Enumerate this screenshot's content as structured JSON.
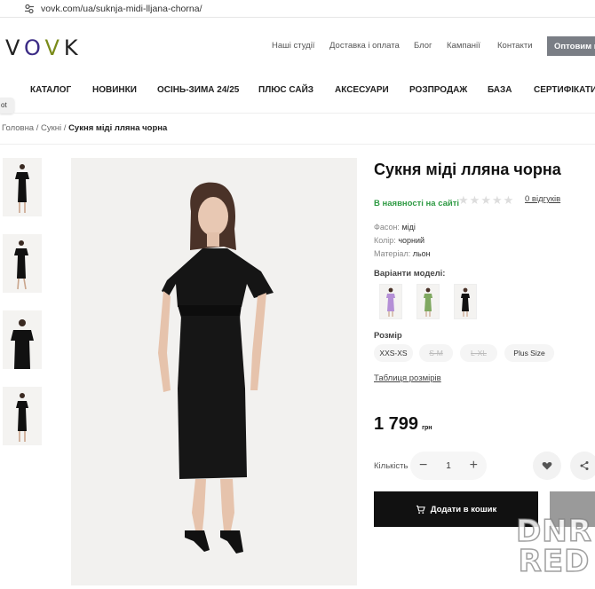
{
  "browser": {
    "url": "vovk.com/ua/suknja-midi-lljana-chorna/"
  },
  "header": {
    "logo": "VOVK",
    "top_links": [
      "Наші студії",
      "Доставка і оплата",
      "Блог",
      "Кампанії",
      "Контакти"
    ],
    "wholesale_label": "Оптовим п"
  },
  "main_nav": [
    "КАТАЛОГ",
    "НОВИНКИ",
    "ОСІНЬ-ЗИМА 24/25",
    "ПЛЮС САЙЗ",
    "АКСЕСУАРИ",
    "РОЗПРОДАЖ",
    "БАЗА",
    "СЕРТИФІКАТИ"
  ],
  "side_tab": "ot",
  "breadcrumb": {
    "home": "Головна",
    "sep": "/",
    "category": "Сукні",
    "current": "Сукня міді лляна чорна"
  },
  "product": {
    "title": "Сукня міді лляна чорна",
    "availability": "В наявності на сайті",
    "rating": 0,
    "reviews": "0 відгуків",
    "attributes": [
      {
        "label": "Фасон:",
        "value": "міді"
      },
      {
        "label": "Колір:",
        "value": "чорний"
      },
      {
        "label": "Матеріал:",
        "value": "льон"
      }
    ],
    "variants_label": "Варіанти моделі:",
    "variant_colors": [
      "#b48fd6",
      "#7fa860",
      "#111111"
    ],
    "size_label": "Розмір",
    "sizes": [
      {
        "label": "XXS-XS",
        "available": true
      },
      {
        "label": "S-M",
        "available": false
      },
      {
        "label": "L-XL",
        "available": false
      },
      {
        "label": "Plus Size",
        "available": true
      }
    ],
    "size_table": "Таблиця розмірів",
    "price": "1 799",
    "currency": "грн",
    "qty_label": "Кількість",
    "qty": "1",
    "add_to_cart": "Додати в кошик"
  },
  "watermark": {
    "line1": "DNR",
    "line2": "RED"
  },
  "colors": {
    "accent_green": "#2e9a43",
    "button_dark": "#111111",
    "wholesale_gray": "#7a7e85"
  }
}
